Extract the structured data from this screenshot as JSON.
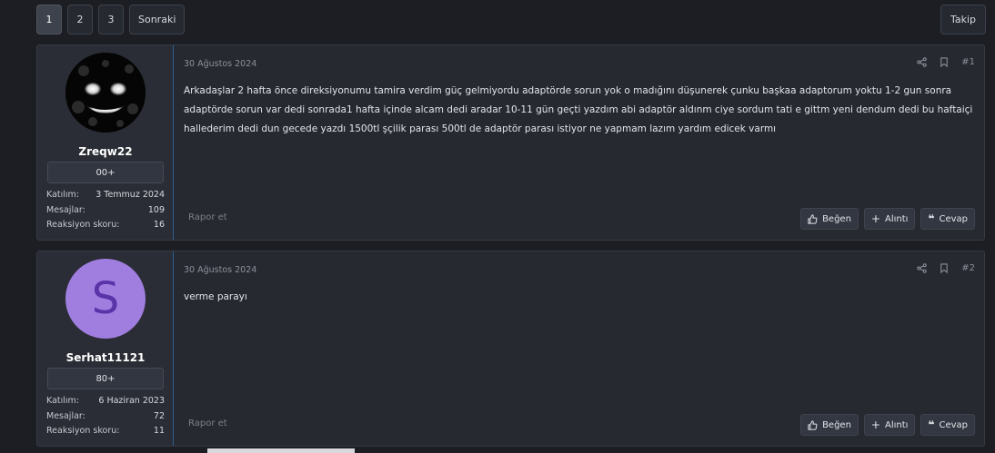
{
  "pagination": {
    "pages": [
      "1",
      "2",
      "3"
    ],
    "next_label": "Sonraki"
  },
  "follow_label": "Takip",
  "posts": [
    {
      "date": "30 Ağustos 2024",
      "number": "#1",
      "username": "Zreqw22",
      "user_title": "00+",
      "stats": {
        "joined_label": "Katılım:",
        "joined": "3 Temmuz 2024",
        "messages_label": "Mesajlar:",
        "messages": "109",
        "reaction_label": "Reaksiyon skoru:",
        "reaction": "16"
      },
      "body": "Arkadaşlar 2 hafta önce direksiyonumu tamira verdim güç gelmiyordu adaptörde sorun yok o madığını düşunerek çunku başkaa adaptorum yoktu 1-2 gun sonra adaptörde sorun var dedi sonrada1 hafta içinde alcam dedi aradar 10-11 gün geçti yazdım abi adaptör aldınm ciye sordum tati e gittm yeni dendum dedi bu haftaiçi hallederim dedi dun gecede yazdı 1500tl şçilik parası 500tl de adaptör parası istiyor ne yapmam lazım yardım edicek varmı",
      "report": "Rapor et"
    },
    {
      "date": "30 Ağustos 2024",
      "number": "#2",
      "username": "Serhat11121",
      "user_title": "80+",
      "avatar_letter": "S",
      "stats": {
        "joined_label": "Katılım:",
        "joined": "6 Haziran 2023",
        "messages_label": "Mesajlar:",
        "messages": "72",
        "reaction_label": "Reaksiyon skoru:",
        "reaction": "11"
      },
      "body": "verme parayı",
      "report": "Rapor et"
    }
  ],
  "actions": {
    "like": "Beğen",
    "quote": "Alıntı",
    "reply": "Cevap"
  },
  "icons": {
    "share": "share-icon",
    "bookmark": "bookmark-icon",
    "like": "thumbs-up-icon",
    "quote": "plus-icon",
    "reply": "quote-icon"
  },
  "colors": {
    "background": "#1c1e24",
    "card": "#262930",
    "accent_border": "#2c5f8f",
    "avatar_letter_bg": "#a07ee0"
  }
}
